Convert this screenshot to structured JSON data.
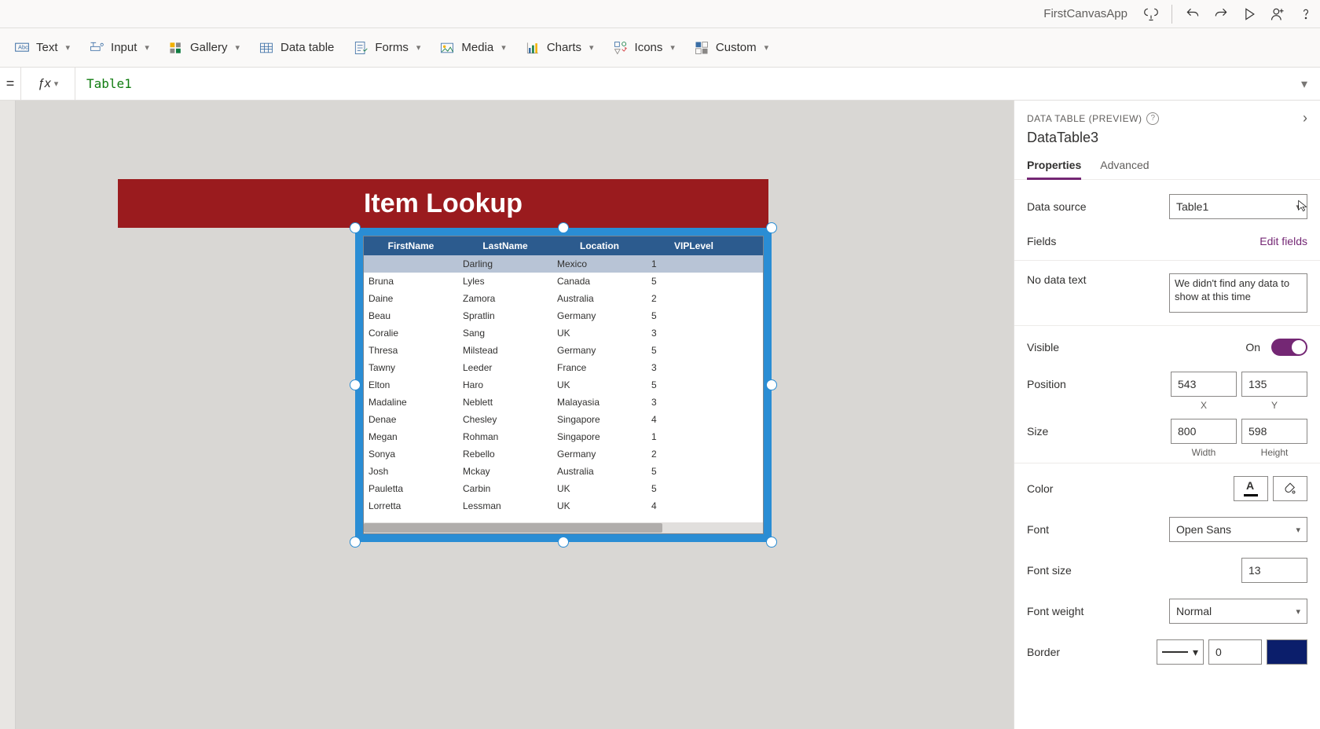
{
  "app": {
    "name": "FirstCanvasApp"
  },
  "ribbon": {
    "text": "Text",
    "input": "Input",
    "gallery": "Gallery",
    "datatable": "Data table",
    "forms": "Forms",
    "media": "Media",
    "charts": "Charts",
    "icons": "Icons",
    "custom": "Custom"
  },
  "formulabar": {
    "eq": "=",
    "value": "Table1"
  },
  "canvas": {
    "title": "Item Lookup",
    "columns": [
      "FirstName",
      "LastName",
      "Location",
      "VIPLevel"
    ],
    "rows": [
      {
        "fn": "",
        "ln": "Darling",
        "loc": "Mexico",
        "vip": "1"
      },
      {
        "fn": "Bruna",
        "ln": "Lyles",
        "loc": "Canada",
        "vip": "5"
      },
      {
        "fn": "Daine",
        "ln": "Zamora",
        "loc": "Australia",
        "vip": "2"
      },
      {
        "fn": "Beau",
        "ln": "Spratlin",
        "loc": "Germany",
        "vip": "5"
      },
      {
        "fn": "Coralie",
        "ln": "Sang",
        "loc": "UK",
        "vip": "3"
      },
      {
        "fn": "Thresa",
        "ln": "Milstead",
        "loc": "Germany",
        "vip": "5"
      },
      {
        "fn": "Tawny",
        "ln": "Leeder",
        "loc": "France",
        "vip": "3"
      },
      {
        "fn": "Elton",
        "ln": "Haro",
        "loc": "UK",
        "vip": "5"
      },
      {
        "fn": "Madaline",
        "ln": "Neblett",
        "loc": "Malayasia",
        "vip": "3"
      },
      {
        "fn": "Denae",
        "ln": "Chesley",
        "loc": "Singapore",
        "vip": "4"
      },
      {
        "fn": "Megan",
        "ln": "Rohman",
        "loc": "Singapore",
        "vip": "1"
      },
      {
        "fn": "Sonya",
        "ln": "Rebello",
        "loc": "Germany",
        "vip": "2"
      },
      {
        "fn": "Josh",
        "ln": "Mckay",
        "loc": "Australia",
        "vip": "5"
      },
      {
        "fn": "Pauletta",
        "ln": "Carbin",
        "loc": "UK",
        "vip": "5"
      },
      {
        "fn": "Lorretta",
        "ln": "Lessman",
        "loc": "UK",
        "vip": "4"
      }
    ]
  },
  "properties": {
    "panel_label": "DATA TABLE (PREVIEW)",
    "control_name": "DataTable3",
    "tabs": {
      "properties": "Properties",
      "advanced": "Advanced"
    },
    "data_source_label": "Data source",
    "data_source_value": "Table1",
    "fields_label": "Fields",
    "edit_fields": "Edit fields",
    "no_data_label": "No data text",
    "no_data_value": "We didn't find any data to show at this time",
    "visible_label": "Visible",
    "visible_value": "On",
    "position_label": "Position",
    "position_x": "543",
    "position_y": "135",
    "x_label": "X",
    "y_label": "Y",
    "size_label": "Size",
    "size_w": "800",
    "size_h": "598",
    "width_label": "Width",
    "height_label": "Height",
    "color_label": "Color",
    "font_label": "Font",
    "font_value": "Open Sans",
    "fontsize_label": "Font size",
    "fontsize_value": "13",
    "fontweight_label": "Font weight",
    "fontweight_value": "Normal",
    "border_label": "Border",
    "border_value": "0"
  }
}
